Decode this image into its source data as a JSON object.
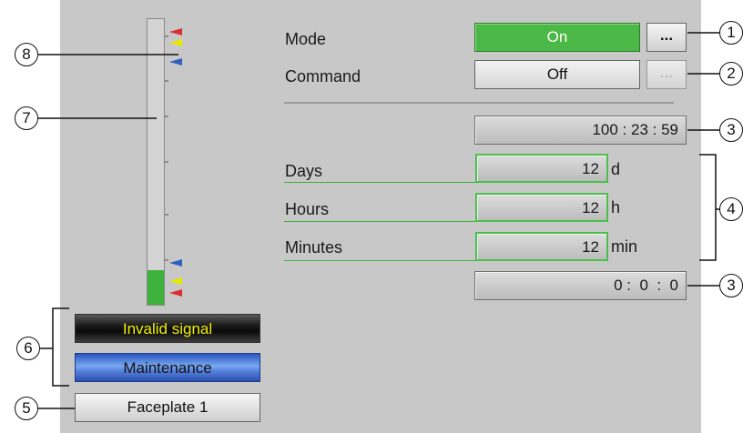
{
  "mode": {
    "label": "Mode",
    "value": "On",
    "dots": "..."
  },
  "command": {
    "label": "Command",
    "value": "Off",
    "dots": "..."
  },
  "time_total": {
    "value": "100 : 23 : 59"
  },
  "days": {
    "label": "Days",
    "value": "12",
    "unit": "d"
  },
  "hours": {
    "label": "Hours",
    "value": "12",
    "unit": "h"
  },
  "minutes": {
    "label": "Minutes",
    "value": "12",
    "unit": "min"
  },
  "time_remaining": {
    "value": "0 :  0  :  0"
  },
  "status": {
    "invalid_signal": "Invalid signal",
    "maintenance": "Maintenance"
  },
  "faceplate": {
    "label": "Faceplate 1"
  },
  "bar": {
    "level_fraction": 0.12
  },
  "callouts": {
    "c1": "1",
    "c2": "2",
    "c3a": "3",
    "c3b": "3",
    "c4": "4",
    "c5": "5",
    "c6": "6",
    "c7": "7",
    "c8": "8"
  },
  "colors": {
    "on_green": "#4cb848",
    "status_yellow": "#f0f000",
    "maintenance_blue": "#3a6ed8",
    "limit_red": "#d83030",
    "limit_yellow": "#e8e800",
    "limit_blue": "#3060c0"
  }
}
